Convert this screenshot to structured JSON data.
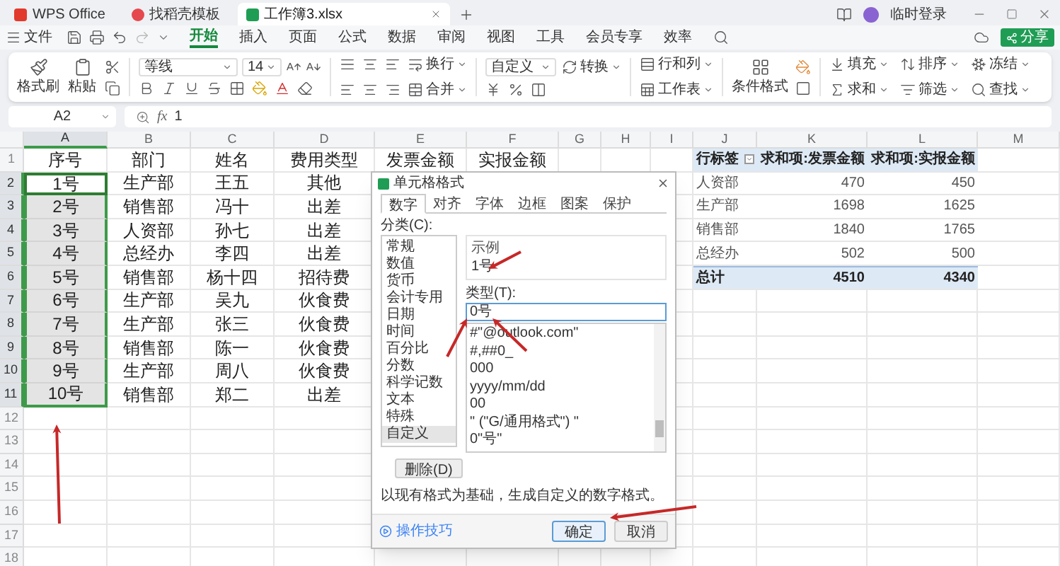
{
  "title_bar": {
    "tabs": [
      {
        "label": "WPS Office",
        "kind": "home",
        "selected": false
      },
      {
        "label": "找稻壳模板",
        "kind": "template",
        "selected": false
      },
      {
        "label": "工作簿3.xlsx",
        "kind": "sheet",
        "selected": true
      }
    ],
    "user": "临时登录"
  },
  "menu": {
    "file": "文件",
    "tabs": [
      {
        "label": "开始",
        "selected": true
      },
      {
        "label": "插入",
        "selected": false
      },
      {
        "label": "页面",
        "selected": false
      },
      {
        "label": "公式",
        "selected": false
      },
      {
        "label": "数据",
        "selected": false
      },
      {
        "label": "审阅",
        "selected": false
      },
      {
        "label": "视图",
        "selected": false
      },
      {
        "label": "工具",
        "selected": false
      },
      {
        "label": "会员专享",
        "selected": false
      },
      {
        "label": "效率",
        "selected": false
      }
    ],
    "share": "分享"
  },
  "ribbon": {
    "format_painter": "格式刷",
    "paste": "粘贴",
    "font": "等线",
    "size": "14",
    "wrap": "换行",
    "merge": "合并",
    "number_format": "自定义",
    "convert": "转换",
    "rows_cols": "行和列",
    "worksheet": "工作表",
    "conditional": "条件格式",
    "fill": "填充",
    "sort": "排序",
    "freeze": "冻结",
    "sum": "求和",
    "filter": "筛选",
    "find": "查找"
  },
  "formula_bar": {
    "cell": "A2",
    "fx": "fx",
    "value": "1"
  },
  "sheet": {
    "columns": [
      {
        "label": "A",
        "selected": true
      },
      {
        "label": "B",
        "selected": false
      },
      {
        "label": "C",
        "selected": false
      },
      {
        "label": "D",
        "selected": false
      },
      {
        "label": "E",
        "selected": false
      },
      {
        "label": "F",
        "selected": false
      },
      {
        "label": "G",
        "selected": false
      },
      {
        "label": "H",
        "selected": false
      },
      {
        "label": "I",
        "selected": false
      },
      {
        "label": "J",
        "selected": false
      },
      {
        "label": "K",
        "selected": false
      },
      {
        "label": "L",
        "selected": false
      },
      {
        "label": "M",
        "selected": false
      }
    ],
    "rows": [
      {
        "number": "1",
        "selected": false,
        "active": false,
        "cells": [
          "序号",
          "部门",
          "姓名",
          "费用类型",
          "发票金额",
          "实报金额"
        ]
      },
      {
        "number": "2",
        "selected": true,
        "active": true,
        "cells": [
          "1号",
          "生产部",
          "王五",
          "其他"
        ]
      },
      {
        "number": "3",
        "selected": true,
        "active": false,
        "cells": [
          "2号",
          "销售部",
          "冯十",
          "出差"
        ]
      },
      {
        "number": "4",
        "selected": true,
        "active": false,
        "cells": [
          "3号",
          "人资部",
          "孙七",
          "出差"
        ]
      },
      {
        "number": "5",
        "selected": true,
        "active": false,
        "cells": [
          "4号",
          "总经办",
          "李四",
          "出差"
        ]
      },
      {
        "number": "6",
        "selected": true,
        "active": false,
        "cells": [
          "5号",
          "销售部",
          "杨十四",
          "招待费"
        ]
      },
      {
        "number": "7",
        "selected": true,
        "active": false,
        "cells": [
          "6号",
          "生产部",
          "吴九",
          "伙食费"
        ]
      },
      {
        "number": "8",
        "selected": true,
        "active": false,
        "cells": [
          "7号",
          "生产部",
          "张三",
          "伙食费"
        ]
      },
      {
        "number": "9",
        "selected": true,
        "active": false,
        "cells": [
          "8号",
          "销售部",
          "陈一",
          "伙食费"
        ]
      },
      {
        "number": "10",
        "selected": true,
        "active": false,
        "cells": [
          "9号",
          "生产部",
          "周八",
          "伙食费"
        ]
      },
      {
        "number": "11",
        "selected": true,
        "active": false,
        "cells": [
          "10号",
          "销售部",
          "郑二",
          "出差"
        ]
      },
      {
        "number": "12",
        "selected": false,
        "active": false
      },
      {
        "number": "13",
        "selected": false,
        "active": false
      },
      {
        "number": "14",
        "selected": false,
        "active": false
      },
      {
        "number": "15",
        "selected": false,
        "active": false
      },
      {
        "number": "16",
        "selected": false,
        "active": false
      },
      {
        "number": "17",
        "selected": false,
        "active": false
      },
      {
        "number": "18",
        "selected": false,
        "active": false
      }
    ]
  },
  "pivot": {
    "header": [
      "行标签",
      "求和项:发票金额",
      "求和项:实报金额"
    ],
    "rows": [
      [
        "人资部",
        "470",
        "450"
      ],
      [
        "生产部",
        "1698",
        "1625"
      ],
      [
        "销售部",
        "1840",
        "1765"
      ],
      [
        "总经办",
        "502",
        "500"
      ]
    ],
    "total": [
      "总计",
      "4510",
      "4340"
    ]
  },
  "dialog": {
    "title": "单元格格式",
    "tabs": [
      {
        "label": "数字",
        "selected": true
      },
      {
        "label": "对齐",
        "selected": false
      },
      {
        "label": "字体",
        "selected": false
      },
      {
        "label": "边框",
        "selected": false
      },
      {
        "label": "图案",
        "selected": false
      },
      {
        "label": "保护",
        "selected": false
      }
    ],
    "category_label": "分类(C):",
    "categories": [
      {
        "label": "常规",
        "selected": false
      },
      {
        "label": "数值",
        "selected": false
      },
      {
        "label": "货币",
        "selected": false
      },
      {
        "label": "会计专用",
        "selected": false
      },
      {
        "label": "日期",
        "selected": false
      },
      {
        "label": "时间",
        "selected": false
      },
      {
        "label": "百分比",
        "selected": false
      },
      {
        "label": "分数",
        "selected": false
      },
      {
        "label": "科学记数",
        "selected": false
      },
      {
        "label": "文本",
        "selected": false
      },
      {
        "label": "特殊",
        "selected": false
      },
      {
        "label": "自定义",
        "selected": true
      }
    ],
    "sample_label": "示例",
    "sample": "1号",
    "type_label": "类型(T):",
    "type_value": "0号",
    "formats": [
      "#\"@outlook.com\"",
      "#,##0_",
      "000",
      "yyyy/mm/dd",
      "00",
      "\" (\"G/通用格式\") \"",
      "0\"号\""
    ],
    "delete": "删除(D)",
    "hint": "以现有格式为基础，生成自定义的数字格式。",
    "tips": "操作技巧",
    "ok": "确定",
    "cancel": "取消"
  }
}
